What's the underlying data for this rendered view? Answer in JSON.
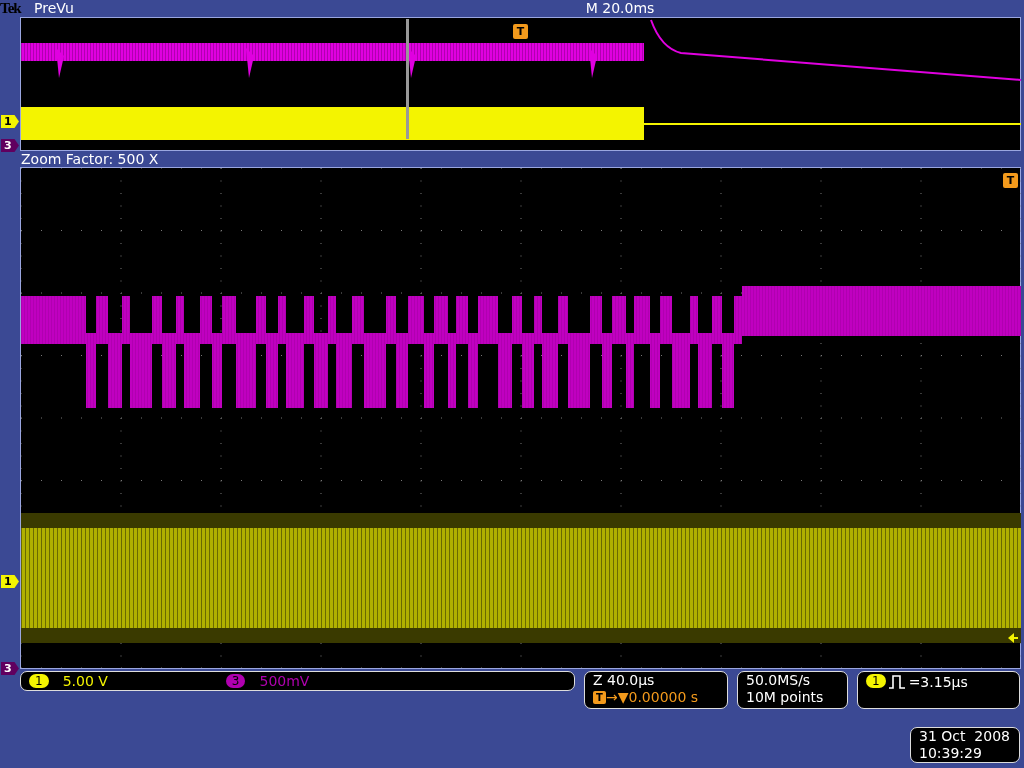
{
  "header": {
    "brand": "Tek",
    "mode": "PreVu",
    "timebase": "M 20.0ms"
  },
  "preview": {
    "trigger": "T",
    "markers": [
      {
        "kind": "ch1",
        "label": "1"
      },
      {
        "kind": "ch3",
        "label": "3"
      }
    ]
  },
  "zoom": {
    "label": "Zoom Factor: 500 X",
    "trigger": "T",
    "markers": [
      {
        "kind": "ch1",
        "label": "1"
      },
      {
        "kind": "ch3",
        "label": "3"
      }
    ]
  },
  "channels": [
    {
      "number": "1",
      "scale": "5.00 V",
      "color": "#f4f400"
    },
    {
      "number": "3",
      "scale": "500mV",
      "color": "#b000b0"
    }
  ],
  "zoom_readout": {
    "scale": "Z 40.0µs",
    "trigger_icon": "T",
    "position": "→▼0.00000 s"
  },
  "acquisition": {
    "rate": "50.0MS/s",
    "length": "10M points"
  },
  "trigger": {
    "kind": "ch1",
    "label": "1",
    "value": "=3.15µs"
  },
  "datetime": {
    "date": "31 Oct  2008",
    "time": "10:39:29"
  }
}
